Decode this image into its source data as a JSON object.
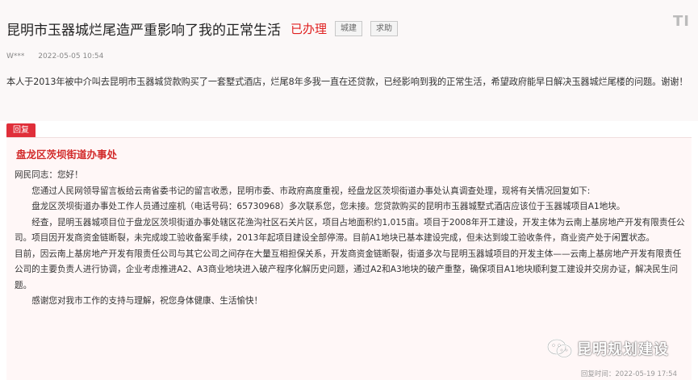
{
  "header": {
    "title": "昆明市玉器城烂尾造严重影响了我的正常生活",
    "status": "已办理",
    "tags": [
      "城建",
      "求助"
    ],
    "corner_logo": "TI"
  },
  "meta": {
    "user": "W***",
    "date": "2022-05-05 10:54"
  },
  "question": {
    "text": "本人于2013年被中介叫去昆明市玉器城贷款购买了一套墅式酒店，烂尾8年多我一直在还贷款，已经影响到我的正常生活，希望政府能早日解决玉器城烂尾楼的问题。谢谢！"
  },
  "reply": {
    "badge": "回复",
    "department": "盘龙区茨坝街道办事处",
    "paragraphs": [
      "网民同志：您好！",
      "您通过人民网领导留言板给云南省委书记的留言收悉，昆明市委、市政府高度重视，经盘龙区茨坝街道办事处认真调查处理，现将有关情况回复如下:",
      "盘龙区茨坝街道办事处工作人员通过座机（电话号码：65730968）多次联系您，您未接。您贷款购买的昆明市玉器城墅式酒店应该位于玉器城项目A1地块。",
      "经查，昆明玉器城项目位于盘龙区茨坝街道办事处辖区花渔沟社区石关片区，项目占地面积约1,015亩。项目于2008年开工建设，开发主体为云南上基房地产开发有限责任公司。项目因开发商资金链断裂，未完成竣工验收备案手续，2013年起项目建设全部停滞。目前A1地块已基本建设完成，但未达到竣工验收条件，商业资产处于闲置状态。",
      "目前，因云南上基房地产开发有限责任公司与其它公司之间存在大量互相担保关系，开发商资金链断裂，街道多次与昆明玉器城项目的开发主体——云南上基房地产开发有限责任公司的主要负责人进行协调，企业考虑推进A2、A3商业地块进入破产程序化解历史问题，通过A2和A3地块的破产重整，确保项目A1地块顺利复工建设并交房办证，解决民生问题。",
      "感谢您对我市工作的支持与理解，祝您身体健康、生活愉快！"
    ],
    "reply_time": "回复时间：2022-05-19 17:54"
  },
  "watermark": {
    "text": "昆明规划建设",
    "icon": "wechat-icon"
  }
}
